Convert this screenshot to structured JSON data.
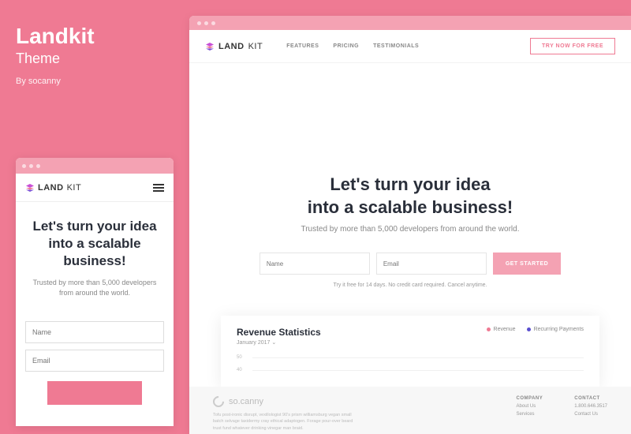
{
  "theme": {
    "title": "Landkit",
    "subtitle": "Theme",
    "author": "By socanny"
  },
  "brand": {
    "name_left": "LAND",
    "name_right": "KIT"
  },
  "nav": [
    "FEATURES",
    "PRICING",
    "TESTIMONIALS"
  ],
  "cta": {
    "try": "TRY NOW FOR FREE",
    "get_started": "GET STARTED"
  },
  "hero": {
    "line1": "Let's turn your idea",
    "line2": "into a scalable business!",
    "tagline": "Trusted by more than 5,000 developers from around the world.",
    "trial": "Try it free for 14 days. No credit card required. Cancel anytime."
  },
  "form": {
    "name_ph": "Name",
    "email_ph": "Email"
  },
  "stats": {
    "title": "Revenue Statistics",
    "date": "January 2017",
    "legend": [
      {
        "label": "Revenue",
        "color": "#ef7a93"
      },
      {
        "label": "Recurring Payments",
        "color": "#5a4fcf"
      }
    ],
    "rows": [
      "50",
      "40"
    ]
  },
  "footer": {
    "brand": "so.canny",
    "desc": "Tofu post-ironic disrupt, vexillologist 90's prism williamsburg vegan small batch selvage taxidermy cray ethical adaptogen. Forage pour-over beard trust fund whatever drinking vinegar man braid.",
    "cols": [
      {
        "title": "COMPANY",
        "items": [
          "About Us",
          "Services"
        ]
      },
      {
        "title": "CONTACT",
        "items": [
          "1.800.646.3517",
          "Contact Us"
        ]
      }
    ]
  }
}
